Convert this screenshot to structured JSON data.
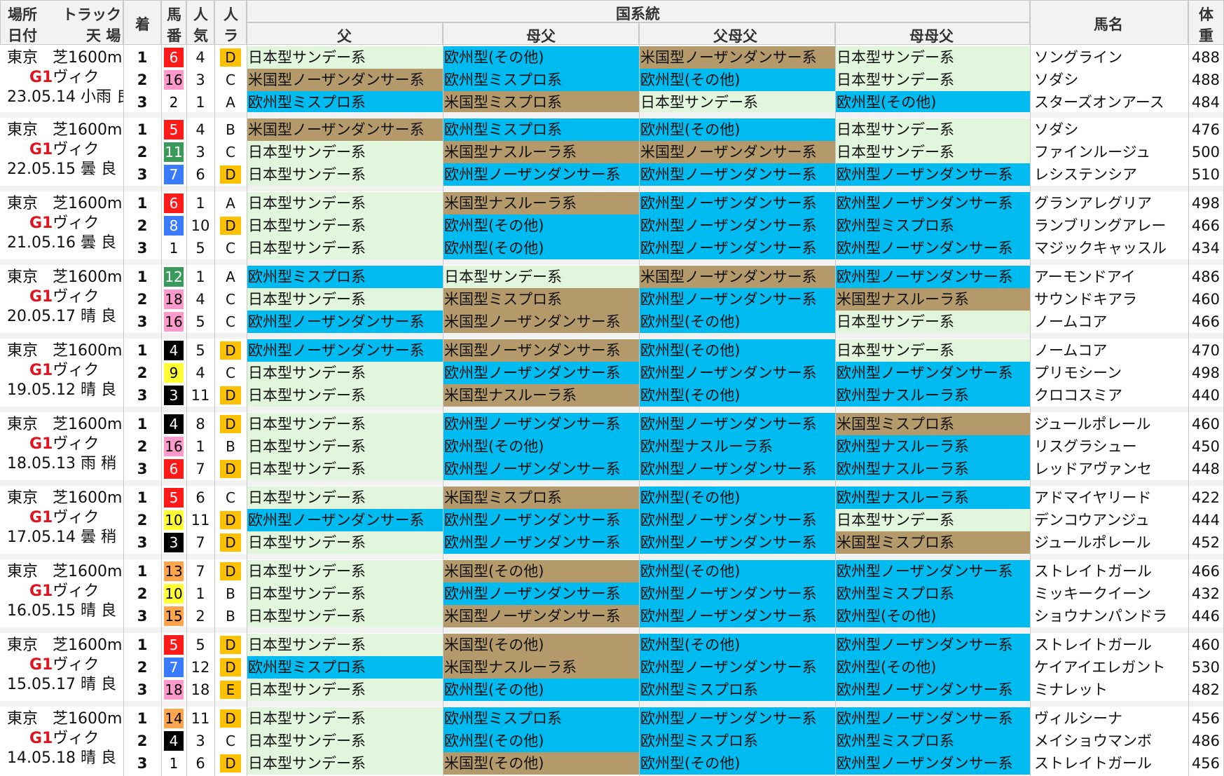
{
  "header": {
    "place_label": "場所",
    "date_label": "日付",
    "track_label": "トラック",
    "weather_label": "天 場",
    "finish_label": "着",
    "horse_no_label_1": "馬",
    "horse_no_label_2": "番",
    "pop_label_1": "人",
    "pop_label_2": "気",
    "ninra_label_1": "人",
    "ninra_label_2": "ラ",
    "lineage_group_label": "国系統",
    "sire_label": "父",
    "damsire_label": "母父",
    "sire_damsire_label": "父母父",
    "dam_damsire_label": "母母父",
    "horse_name_label": "馬名",
    "weight_label_1": "体",
    "weight_label_2": "重"
  },
  "colors": {
    "japan": "#e2f5dd",
    "europe": "#00bbf0",
    "america": "#b49a6a",
    "rank_D": "#ffc000",
    "rank_E": "#ffc000"
  },
  "races": [
    {
      "place": "東京",
      "track": "芝1600m",
      "grade": "G1",
      "race_name": "ヴィク",
      "date": "23.05.14",
      "weather": "小雨",
      "going": "良",
      "rows": [
        {
          "finish": "1",
          "gate": "6",
          "gate_bg": "#ff1a1a",
          "gate_fg": "#ffffff",
          "pop": "4",
          "ninra": "D",
          "sire": "日本型サンデー系",
          "damsire": "欧州型(その他)",
          "sire_damsire": "米国型ノーザンダンサー系",
          "dam_damsire": "日本型サンデー系",
          "name": "ソングライン",
          "weight": "488"
        },
        {
          "finish": "2",
          "gate": "16",
          "gate_bg": "#ff99cc",
          "gate_fg": "#000000",
          "pop": "3",
          "ninra": "C",
          "sire": "米国型ノーザンダンサー系",
          "damsire": "欧州型ミスプロ系",
          "sire_damsire": "欧州型(その他)",
          "dam_damsire": "日本型サンデー系",
          "name": "ソダシ",
          "weight": "488"
        },
        {
          "finish": "3",
          "gate": "2",
          "gate_bg": "#ffffff",
          "gate_fg": "#000000",
          "pop": "1",
          "ninra": "A",
          "sire": "欧州型ミスプロ系",
          "damsire": "米国型ミスプロ系",
          "sire_damsire": "日本型サンデー系",
          "dam_damsire": "欧州型(その他)",
          "name": "スターズオンアース",
          "weight": "484"
        }
      ]
    },
    {
      "place": "東京",
      "track": "芝1600m",
      "grade": "G1",
      "race_name": "ヴィク",
      "date": "22.05.15",
      "weather": "曇",
      "going": "良",
      "rows": [
        {
          "finish": "1",
          "gate": "5",
          "gate_bg": "#ff1a1a",
          "gate_fg": "#ffffff",
          "pop": "4",
          "ninra": "B",
          "sire": "米国型ノーザンダンサー系",
          "damsire": "欧州型ミスプロ系",
          "sire_damsire": "欧州型(その他)",
          "dam_damsire": "日本型サンデー系",
          "name": "ソダシ",
          "weight": "476"
        },
        {
          "finish": "2",
          "gate": "11",
          "gate_bg": "#3a9a5a",
          "gate_fg": "#ffffff",
          "pop": "3",
          "ninra": "C",
          "sire": "日本型サンデー系",
          "damsire": "米国型ナスルーラ系",
          "sire_damsire": "米国型ノーザンダンサー系",
          "dam_damsire": "日本型サンデー系",
          "name": "ファインルージュ",
          "weight": "500"
        },
        {
          "finish": "3",
          "gate": "7",
          "gate_bg": "#3a7aff",
          "gate_fg": "#ffffff",
          "pop": "6",
          "ninra": "D",
          "sire": "日本型サンデー系",
          "damsire": "欧州型ノーザンダンサー系",
          "sire_damsire": "欧州型ノーザンダンサー系",
          "dam_damsire": "欧州型ノーザンダンサー系",
          "name": "レシステンシア",
          "weight": "510"
        }
      ]
    },
    {
      "place": "東京",
      "track": "芝1600m",
      "grade": "G1",
      "race_name": "ヴィク",
      "date": "21.05.16",
      "weather": "曇",
      "going": "良",
      "rows": [
        {
          "finish": "1",
          "gate": "6",
          "gate_bg": "#ff1a1a",
          "gate_fg": "#ffffff",
          "pop": "1",
          "ninra": "A",
          "sire": "日本型サンデー系",
          "damsire": "米国型ナスルーラ系",
          "sire_damsire": "欧州型ノーザンダンサー系",
          "dam_damsire": "欧州型ノーザンダンサー系",
          "name": "グランアレグリア",
          "weight": "498"
        },
        {
          "finish": "2",
          "gate": "8",
          "gate_bg": "#3a7aff",
          "gate_fg": "#ffffff",
          "pop": "10",
          "ninra": "D",
          "sire": "日本型サンデー系",
          "damsire": "欧州型(その他)",
          "sire_damsire": "欧州型ノーザンダンサー系",
          "dam_damsire": "欧州型ミスプロ系",
          "name": "ランブリングアレー",
          "weight": "466"
        },
        {
          "finish": "3",
          "gate": "1",
          "gate_bg": "#ffffff",
          "gate_fg": "#000000",
          "pop": "5",
          "ninra": "C",
          "sire": "日本型サンデー系",
          "damsire": "欧州型(その他)",
          "sire_damsire": "欧州型ノーザンダンサー系",
          "dam_damsire": "欧州型ノーザンダンサー系",
          "name": "マジックキャッスル",
          "weight": "434"
        }
      ]
    },
    {
      "place": "東京",
      "track": "芝1600m",
      "grade": "G1",
      "race_name": "ヴィク",
      "date": "20.05.17",
      "weather": "晴",
      "going": "良",
      "rows": [
        {
          "finish": "1",
          "gate": "12",
          "gate_bg": "#3a9a5a",
          "gate_fg": "#ffffff",
          "pop": "1",
          "ninra": "A",
          "sire": "欧州型ミスプロ系",
          "damsire": "日本型サンデー系",
          "sire_damsire": "米国型ノーザンダンサー系",
          "dam_damsire": "欧州型ノーザンダンサー系",
          "name": "アーモンドアイ",
          "weight": "486"
        },
        {
          "finish": "2",
          "gate": "18",
          "gate_bg": "#ff99cc",
          "gate_fg": "#000000",
          "pop": "4",
          "ninra": "C",
          "sire": "日本型サンデー系",
          "damsire": "米国型ミスプロ系",
          "sire_damsire": "欧州型ノーザンダンサー系",
          "dam_damsire": "米国型ナスルーラ系",
          "name": "サウンドキアラ",
          "weight": "460"
        },
        {
          "finish": "3",
          "gate": "16",
          "gate_bg": "#ff99cc",
          "gate_fg": "#000000",
          "pop": "5",
          "ninra": "C",
          "sire": "欧州型ノーザンダンサー系",
          "damsire": "米国型ノーザンダンサー系",
          "sire_damsire": "欧州型(その他)",
          "dam_damsire": "日本型サンデー系",
          "name": "ノームコア",
          "weight": "466"
        }
      ]
    },
    {
      "place": "東京",
      "track": "芝1600m",
      "grade": "G1",
      "race_name": "ヴィク",
      "date": "19.05.12",
      "weather": "晴",
      "going": "良",
      "rows": [
        {
          "finish": "1",
          "gate": "4",
          "gate_bg": "#000000",
          "gate_fg": "#ffffff",
          "pop": "5",
          "ninra": "D",
          "sire": "欧州型ノーザンダンサー系",
          "damsire": "米国型ノーザンダンサー系",
          "sire_damsire": "欧州型(その他)",
          "dam_damsire": "日本型サンデー系",
          "name": "ノームコア",
          "weight": "470"
        },
        {
          "finish": "2",
          "gate": "9",
          "gate_bg": "#ffff33",
          "gate_fg": "#000000",
          "pop": "4",
          "ninra": "C",
          "sire": "日本型サンデー系",
          "damsire": "欧州型ノーザンダンサー系",
          "sire_damsire": "欧州型ノーザンダンサー系",
          "dam_damsire": "欧州型ノーザンダンサー系",
          "name": "プリモシーン",
          "weight": "498"
        },
        {
          "finish": "3",
          "gate": "3",
          "gate_bg": "#000000",
          "gate_fg": "#ffffff",
          "pop": "11",
          "ninra": "D",
          "sire": "日本型サンデー系",
          "damsire": "米国型ナスルーラ系",
          "sire_damsire": "欧州型(その他)",
          "dam_damsire": "欧州型ナスルーラ系",
          "name": "クロコスミア",
          "weight": "440"
        }
      ]
    },
    {
      "place": "東京",
      "track": "芝1600m",
      "grade": "G1",
      "race_name": "ヴィク",
      "date": "18.05.13",
      "weather": "雨",
      "going": "稍",
      "rows": [
        {
          "finish": "1",
          "gate": "4",
          "gate_bg": "#000000",
          "gate_fg": "#ffffff",
          "pop": "8",
          "ninra": "D",
          "sire": "日本型サンデー系",
          "damsire": "欧州型ノーザンダンサー系",
          "sire_damsire": "欧州型ノーザンダンサー系",
          "dam_damsire": "米国型ミスプロ系",
          "name": "ジュールポレール",
          "weight": "460"
        },
        {
          "finish": "2",
          "gate": "16",
          "gate_bg": "#ff99cc",
          "gate_fg": "#000000",
          "pop": "1",
          "ninra": "B",
          "sire": "日本型サンデー系",
          "damsire": "欧州型(その他)",
          "sire_damsire": "欧州型ナスルーラ系",
          "dam_damsire": "欧州型ナスルーラ系",
          "name": "リスグラシュー",
          "weight": "450"
        },
        {
          "finish": "3",
          "gate": "6",
          "gate_bg": "#ff1a1a",
          "gate_fg": "#ffffff",
          "pop": "7",
          "ninra": "D",
          "sire": "日本型サンデー系",
          "damsire": "欧州型ノーザンダンサー系",
          "sire_damsire": "欧州型ノーザンダンサー系",
          "dam_damsire": "欧州型ナスルーラ系",
          "name": "レッドアヴァンセ",
          "weight": "448"
        }
      ]
    },
    {
      "place": "東京",
      "track": "芝1600m",
      "grade": "G1",
      "race_name": "ヴィク",
      "date": "17.05.14",
      "weather": "曇",
      "going": "稍",
      "rows": [
        {
          "finish": "1",
          "gate": "5",
          "gate_bg": "#ff1a1a",
          "gate_fg": "#ffffff",
          "pop": "6",
          "ninra": "C",
          "sire": "日本型サンデー系",
          "damsire": "米国型ミスプロ系",
          "sire_damsire": "欧州型(その他)",
          "dam_damsire": "欧州型ナスルーラ系",
          "name": "アドマイヤリード",
          "weight": "422"
        },
        {
          "finish": "2",
          "gate": "10",
          "gate_bg": "#ffff33",
          "gate_fg": "#000000",
          "pop": "11",
          "ninra": "D",
          "sire": "欧州型ノーザンダンサー系",
          "damsire": "欧州型ノーザンダンサー系",
          "sire_damsire": "欧州型ノーザンダンサー系",
          "dam_damsire": "日本型サンデー系",
          "name": "デンコウアンジュ",
          "weight": "444"
        },
        {
          "finish": "3",
          "gate": "3",
          "gate_bg": "#000000",
          "gate_fg": "#ffffff",
          "pop": "7",
          "ninra": "D",
          "sire": "日本型サンデー系",
          "damsire": "欧州型ノーザンダンサー系",
          "sire_damsire": "欧州型ノーザンダンサー系",
          "dam_damsire": "米国型ミスプロ系",
          "name": "ジュールポレール",
          "weight": "452"
        }
      ]
    },
    {
      "place": "東京",
      "track": "芝1600m",
      "grade": "G1",
      "race_name": "ヴィク",
      "date": "16.05.15",
      "weather": "晴",
      "going": "良",
      "rows": [
        {
          "finish": "1",
          "gate": "13",
          "gate_bg": "#ffa64d",
          "gate_fg": "#000000",
          "pop": "7",
          "ninra": "D",
          "sire": "日本型サンデー系",
          "damsire": "米国型(その他)",
          "sire_damsire": "欧州型(その他)",
          "dam_damsire": "欧州型ノーザンダンサー系",
          "name": "ストレイトガール",
          "weight": "466"
        },
        {
          "finish": "2",
          "gate": "10",
          "gate_bg": "#ffff33",
          "gate_fg": "#000000",
          "pop": "1",
          "ninra": "B",
          "sire": "日本型サンデー系",
          "damsire": "欧州型ノーザンダンサー系",
          "sire_damsire": "欧州型ノーザンダンサー系",
          "dam_damsire": "欧州型ミスプロ系",
          "name": "ミッキークイーン",
          "weight": "432"
        },
        {
          "finish": "3",
          "gate": "15",
          "gate_bg": "#ffa64d",
          "gate_fg": "#000000",
          "pop": "2",
          "ninra": "B",
          "sire": "日本型サンデー系",
          "damsire": "米国型ノーザンダンサー系",
          "sire_damsire": "欧州型ノーザンダンサー系",
          "dam_damsire": "欧州型(その他)",
          "name": "ショウナンパンドラ",
          "weight": "446"
        }
      ]
    },
    {
      "place": "東京",
      "track": "芝1600m",
      "grade": "G1",
      "race_name": "ヴィク",
      "date": "15.05.17",
      "weather": "晴",
      "going": "良",
      "rows": [
        {
          "finish": "1",
          "gate": "5",
          "gate_bg": "#ff1a1a",
          "gate_fg": "#ffffff",
          "pop": "5",
          "ninra": "D",
          "sire": "日本型サンデー系",
          "damsire": "米国型(その他)",
          "sire_damsire": "欧州型(その他)",
          "dam_damsire": "欧州型ノーザンダンサー系",
          "name": "ストレイトガール",
          "weight": "460"
        },
        {
          "finish": "2",
          "gate": "7",
          "gate_bg": "#3a7aff",
          "gate_fg": "#ffffff",
          "pop": "12",
          "ninra": "D",
          "sire": "欧州型ミスプロ系",
          "damsire": "米国型ナスルーラ系",
          "sire_damsire": "欧州型ノーザンダンサー系",
          "dam_damsire": "欧州型(その他)",
          "name": "ケイアイエレガント",
          "weight": "530"
        },
        {
          "finish": "3",
          "gate": "18",
          "gate_bg": "#ff99cc",
          "gate_fg": "#000000",
          "pop": "18",
          "ninra": "E",
          "sire": "日本型サンデー系",
          "damsire": "欧州型(その他)",
          "sire_damsire": "欧州型ミスプロ系",
          "dam_damsire": "欧州型ノーザンダンサー系",
          "name": "ミナレット",
          "weight": "482"
        }
      ]
    },
    {
      "place": "東京",
      "track": "芝1600m",
      "grade": "G1",
      "race_name": "ヴィク",
      "date": "14.05.18",
      "weather": "晴",
      "going": "良",
      "rows": [
        {
          "finish": "1",
          "gate": "14",
          "gate_bg": "#ffa64d",
          "gate_fg": "#000000",
          "pop": "11",
          "ninra": "D",
          "sire": "日本型サンデー系",
          "damsire": "欧州型ミスプロ系",
          "sire_damsire": "欧州型ノーザンダンサー系",
          "dam_damsire": "欧州型ノーザンダンサー系",
          "name": "ヴィルシーナ",
          "weight": "456"
        },
        {
          "finish": "2",
          "gate": "4",
          "gate_bg": "#000000",
          "gate_fg": "#ffffff",
          "pop": "3",
          "ninra": "C",
          "sire": "日本型サンデー系",
          "damsire": "欧州型(その他)",
          "sire_damsire": "欧州型ミスプロ系",
          "dam_damsire": "欧州型ミスプロ系",
          "name": "メイショウマンボ",
          "weight": "486"
        },
        {
          "finish": "3",
          "gate": "1",
          "gate_bg": "#ffffff",
          "gate_fg": "#000000",
          "pop": "6",
          "ninra": "D",
          "sire": "日本型サンデー系",
          "damsire": "米国型(その他)",
          "sire_damsire": "欧州型(その他)",
          "dam_damsire": "欧州型ノーザンダンサー系",
          "name": "ストレイトガール",
          "weight": "456"
        }
      ]
    }
  ]
}
